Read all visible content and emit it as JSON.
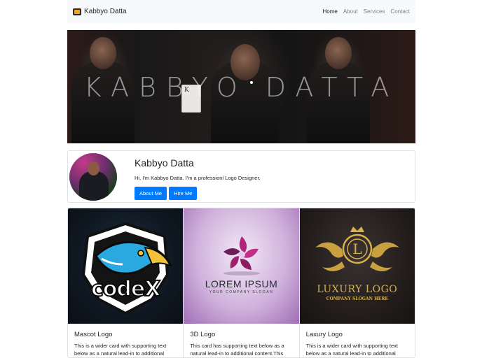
{
  "navbar": {
    "brand": "Kabbyo Datta",
    "links": [
      {
        "label": "Home"
      },
      {
        "label": "About"
      },
      {
        "label": "Services"
      },
      {
        "label": "Contact"
      }
    ]
  },
  "banner": {
    "title": "KABBYO DATTA"
  },
  "profile": {
    "name": "Kabbyo Datta",
    "bio": "Hi, I'm Kabbyo Datta. I'm a professionl Logo Designer.",
    "about_button": "About Me",
    "hire_button": "Hire Me"
  },
  "cards": [
    {
      "title": "Mascot Logo",
      "text": "This is a wider card with supporting text below as a natural lead-in to additional",
      "logo_text": "codeX"
    },
    {
      "title": "3D Logo",
      "text": "This card has supporting text below as a natural lead-in to additional content.This card",
      "logo_text": "LOREM IPSUM",
      "logo_sub": "YOUR COMPANY SLOGAN"
    },
    {
      "title": "Laxury Logo",
      "text": "This is a wider card with supporting text below as a natural lead-in to additional",
      "logo_text": "LUXURY LOGO",
      "logo_sub": "COMPANY SLOGAN HERE"
    }
  ],
  "colors": {
    "primary": "#007bff",
    "navbar_bg": "#f8f9fa"
  }
}
